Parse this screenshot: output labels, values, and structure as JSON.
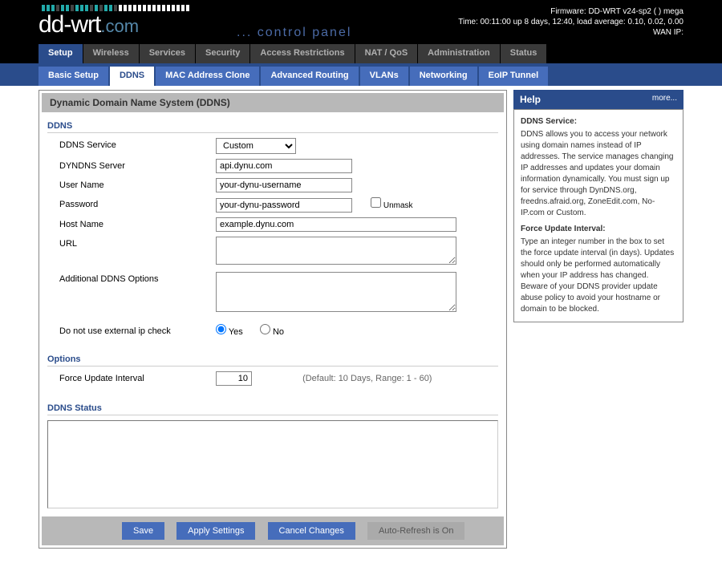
{
  "header": {
    "logo_main": "dd-wrt",
    "logo_com": ".com",
    "control_panel": "... control panel",
    "firmware_line": "Firmware: DD-WRT v24-sp2 (           ) mega",
    "time_line": "Time: 00:11:00 up 8 days, 12:40, load average: 0.10, 0.02, 0.00",
    "wan_line": "WAN IP:"
  },
  "main_tabs": [
    "Setup",
    "Wireless",
    "Services",
    "Security",
    "Access Restrictions",
    "NAT / QoS",
    "Administration",
    "Status"
  ],
  "main_tab_active": 0,
  "sub_tabs": [
    "Basic Setup",
    "DDNS",
    "MAC Address Clone",
    "Advanced Routing",
    "VLANs",
    "Networking",
    "EoIP Tunnel"
  ],
  "sub_tab_active": 1,
  "panel_title": "Dynamic Domain Name System (DDNS)",
  "sections": {
    "ddns": {
      "legend": "DDNS",
      "service_label": "DDNS Service",
      "service_value": "Custom",
      "server_label": "DYNDNS Server",
      "server_value": "api.dynu.com",
      "user_label": "User Name",
      "user_value": "your-dynu-username",
      "pass_label": "Password",
      "pass_value": "your-dynu-password",
      "unmask_label": "Unmask",
      "host_label": "Host Name",
      "host_value": "example.dynu.com",
      "url_label": "URL",
      "url_value": "",
      "addl_label": "Additional DDNS Options",
      "addl_value": "",
      "extip_label": "Do not use external ip check",
      "radio_yes": "Yes",
      "radio_no": "No"
    },
    "options": {
      "legend": "Options",
      "interval_label": "Force Update Interval",
      "interval_value": "10",
      "interval_hint": "(Default: 10 Days, Range: 1 - 60)"
    },
    "status": {
      "legend": "DDNS Status"
    }
  },
  "buttons": {
    "save": "Save",
    "apply": "Apply Settings",
    "cancel": "Cancel Changes",
    "auto": "Auto-Refresh is On"
  },
  "help": {
    "title": "Help",
    "more": "more...",
    "h1": "DDNS Service:",
    "p1": "DDNS allows you to access your network using domain names instead of IP addresses. The service manages changing IP addresses and updates your domain information dynamically. You must sign up for service through DynDNS.org, freedns.afraid.org, ZoneEdit.com, No-IP.com or Custom.",
    "h2": "Force Update Interval:",
    "p2": "Type an integer number in the box to set the force update interval (in days). Updates should only be performed automatically when your IP address has changed. Beware of your DDNS provider update abuse policy to avoid your hostname or domain to be blocked."
  }
}
